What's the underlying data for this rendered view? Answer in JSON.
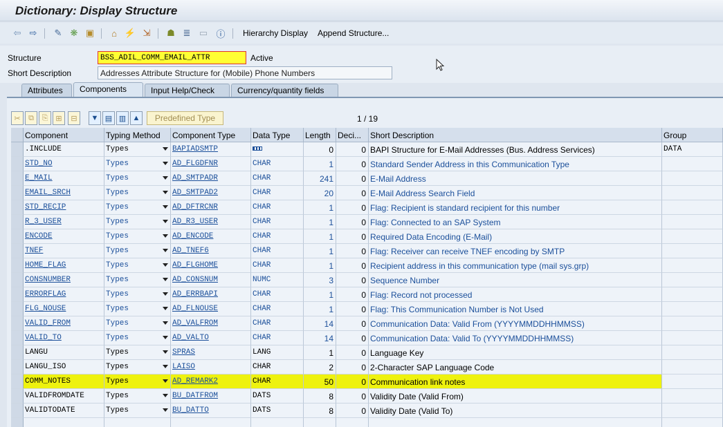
{
  "window": {
    "title": "Dictionary: Display Structure"
  },
  "toolbar": {
    "hierarchy_display": "Hierarchy Display",
    "append_structure": "Append Structure..."
  },
  "form": {
    "structure_label": "Structure",
    "structure_value": "BSS_ADIL_COMM_EMAIL_ATTR",
    "status": "Active",
    "short_desc_label": "Short Description",
    "short_desc_value": "Addresses Attribute Structure for (Mobile) Phone Numbers"
  },
  "tabs": [
    "Attributes",
    "Components",
    "Input Help/Check",
    "Currency/quantity fields"
  ],
  "table_controls": {
    "predefined_type": "Predefined Type",
    "pager": "1 / 19"
  },
  "columns": [
    "Component",
    "Typing Method",
    "Component Type",
    "Data Type",
    "Length",
    "Deci...",
    "Short Description",
    "Group"
  ],
  "rows": [
    {
      "component": ".INCLUDE",
      "typing": "Types",
      "comp_type": "BAPIADSMTP",
      "data_type": "",
      "length": "0",
      "dec": "0",
      "desc": "BAPI Structure for E-Mail Addresses (Bus. Address Services)",
      "group": "DATA"
    },
    {
      "component": "STD_NO",
      "typing": "Types",
      "comp_type": "AD_FLGDFNR",
      "data_type": "CHAR",
      "length": "1",
      "dec": "0",
      "desc": "Standard Sender Address in this Communication Type",
      "group": ""
    },
    {
      "component": "E_MAIL",
      "typing": "Types",
      "comp_type": "AD_SMTPADR",
      "data_type": "CHAR",
      "length": "241",
      "dec": "0",
      "desc": "E-Mail Address",
      "group": ""
    },
    {
      "component": "EMAIL_SRCH",
      "typing": "Types",
      "comp_type": "AD_SMTPAD2",
      "data_type": "CHAR",
      "length": "20",
      "dec": "0",
      "desc": "E-Mail Address Search Field",
      "group": ""
    },
    {
      "component": "STD_RECIP",
      "typing": "Types",
      "comp_type": "AD_DFTRCNR",
      "data_type": "CHAR",
      "length": "1",
      "dec": "0",
      "desc": "Flag: Recipient is standard recipient for this number",
      "group": ""
    },
    {
      "component": "R_3_USER",
      "typing": "Types",
      "comp_type": "AD_R3_USER",
      "data_type": "CHAR",
      "length": "1",
      "dec": "0",
      "desc": "Flag: Connected to an SAP System",
      "group": ""
    },
    {
      "component": "ENCODE",
      "typing": "Types",
      "comp_type": "AD_ENCODE",
      "data_type": "CHAR",
      "length": "1",
      "dec": "0",
      "desc": "Required Data Encoding (E-Mail)",
      "group": ""
    },
    {
      "component": "TNEF",
      "typing": "Types",
      "comp_type": "AD_TNEF6",
      "data_type": "CHAR",
      "length": "1",
      "dec": "0",
      "desc": "Flag: Receiver can receive TNEF encoding by SMTP",
      "group": ""
    },
    {
      "component": "HOME_FLAG",
      "typing": "Types",
      "comp_type": "AD_FLGHOME",
      "data_type": "CHAR",
      "length": "1",
      "dec": "0",
      "desc": "Recipient address in this communication type (mail sys.grp)",
      "group": ""
    },
    {
      "component": "CONSNUMBER",
      "typing": "Types",
      "comp_type": "AD_CONSNUM",
      "data_type": "NUMC",
      "length": "3",
      "dec": "0",
      "desc": "Sequence Number",
      "group": ""
    },
    {
      "component": "ERRORFLAG",
      "typing": "Types",
      "comp_type": "AD_ERRBAPI",
      "data_type": "CHAR",
      "length": "1",
      "dec": "0",
      "desc": "Flag: Record not processed",
      "group": ""
    },
    {
      "component": "FLG_NOUSE",
      "typing": "Types",
      "comp_type": "AD_FLNOUSE",
      "data_type": "CHAR",
      "length": "1",
      "dec": "0",
      "desc": "Flag: This Communication Number is Not Used",
      "group": ""
    },
    {
      "component": "VALID_FROM",
      "typing": "Types",
      "comp_type": "AD_VALFROM",
      "data_type": "CHAR",
      "length": "14",
      "dec": "0",
      "desc": "Communication Data: Valid From (YYYYMMDDHHMMSS)",
      "group": ""
    },
    {
      "component": "VALID_TO",
      "typing": "Types",
      "comp_type": "AD_VALTO",
      "data_type": "CHAR",
      "length": "14",
      "dec": "0",
      "desc": "Communication Data: Valid To (YYYYMMDDHHMMSS)",
      "group": ""
    },
    {
      "component": "LANGU",
      "typing": "Types",
      "comp_type": "SPRAS",
      "data_type": "LANG",
      "length": "1",
      "dec": "0",
      "desc": "Language Key",
      "group": ""
    },
    {
      "component": "LANGU_ISO",
      "typing": "Types",
      "comp_type": "LAISO",
      "data_type": "CHAR",
      "length": "2",
      "dec": "0",
      "desc": "2-Character SAP Language Code",
      "group": ""
    },
    {
      "component": "COMM_NOTES",
      "typing": "Types",
      "comp_type": "AD_REMARK2",
      "data_type": "CHAR",
      "length": "50",
      "dec": "0",
      "desc": "Communication link notes",
      "group": ""
    },
    {
      "component": "VALIDFROMDATE",
      "typing": "Types",
      "comp_type": "BU_DATFROM",
      "data_type": "DATS",
      "length": "8",
      "dec": "0",
      "desc": "Validity Date (Valid From)",
      "group": ""
    },
    {
      "component": "VALIDTODATE",
      "typing": "Types",
      "comp_type": "BU_DATTO",
      "data_type": "DATS",
      "length": "8",
      "dec": "0",
      "desc": "Validity Date (Valid To)",
      "group": ""
    }
  ],
  "highlight_row": 16,
  "colors": {
    "highlight": "#eef20f",
    "link": "#1b4f9a"
  }
}
